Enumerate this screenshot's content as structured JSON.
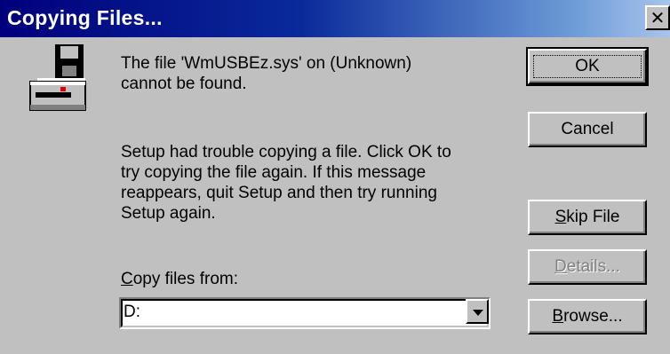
{
  "window": {
    "title": "Copying Files...",
    "close_glyph": "✕"
  },
  "message": {
    "line1": "The file  'WmUSBEz.sys' on (Unknown)",
    "line2": "cannot be found.",
    "detail_lines": [
      "Setup had trouble copying a file. Click OK to",
      "try copying the file again. If this message",
      "reappears, quit Setup and then try running",
      "Setup again."
    ]
  },
  "copy_from": {
    "label_prefix": "C",
    "label_rest": "opy files from:",
    "value": "D:"
  },
  "buttons": {
    "ok": "OK",
    "cancel": "Cancel",
    "skip_prefix": "S",
    "skip_rest": "kip File",
    "details_prefix": "D",
    "details_rest": "etails...",
    "browse_prefix": "B",
    "browse_rest": "rowse..."
  },
  "icons": {
    "drive": "floppy-drive-icon",
    "close": "close-icon",
    "dropdown": "chevron-down-icon"
  },
  "colors": {
    "face": "#c0c0c0",
    "titlebar_start": "#00007b",
    "titlebar_end": "#a8c4ec",
    "disabled_text": "#808080"
  }
}
